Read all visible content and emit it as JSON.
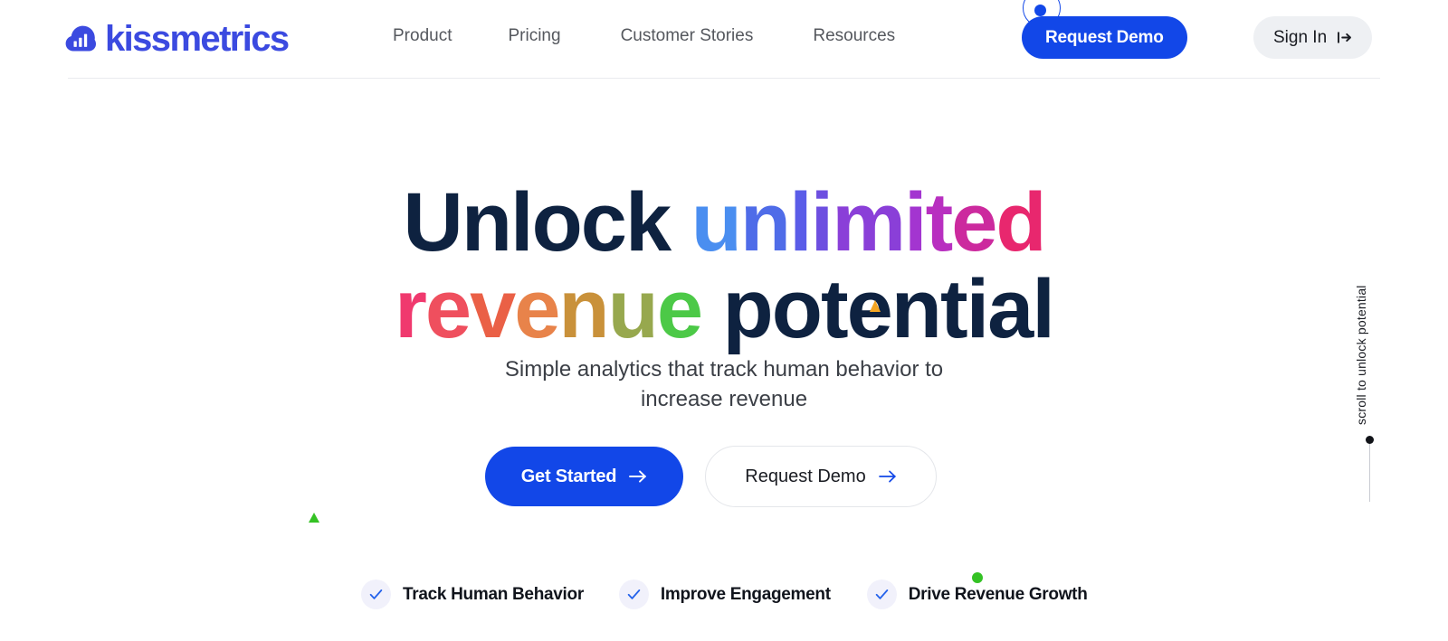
{
  "brand": {
    "name": "kissmetrics",
    "logo_icon": "cloud-bar-chart-icon",
    "color": "#3b4ae0"
  },
  "header": {
    "nav": [
      {
        "label": "Product"
      },
      {
        "label": "Pricing"
      },
      {
        "label": "Customer Stories"
      },
      {
        "label": "Resources"
      }
    ],
    "request_demo_label": "Request Demo",
    "request_demo_color": "#1247e8",
    "signin_label": "Sign In",
    "signin_icon": "sign-in-arrow-icon",
    "signin_bg": "#eef0f3"
  },
  "hero": {
    "headline_line1": [
      {
        "t": "U",
        "c": "#0e2240"
      },
      {
        "t": "n",
        "c": "#0e2240"
      },
      {
        "t": "l",
        "c": "#0e2240"
      },
      {
        "t": "o",
        "c": "#0e2240"
      },
      {
        "t": "c",
        "c": "#0e2240"
      },
      {
        "t": "k",
        "c": "#0e2240"
      },
      {
        "t": " ",
        "c": "#0e2240"
      },
      {
        "t": "u",
        "c": "#4a8ef0"
      },
      {
        "t": "n",
        "c": "#4f6ce8"
      },
      {
        "t": "l",
        "c": "#5a5ce8"
      },
      {
        "t": "i",
        "c": "#6d4fe0"
      },
      {
        "t": "m",
        "c": "#8a3fd8"
      },
      {
        "t": "i",
        "c": "#a335d0"
      },
      {
        "t": "t",
        "c": "#b82fc0"
      },
      {
        "t": "e",
        "c": "#cc2a9e"
      },
      {
        "t": "d",
        "c": "#e8276e"
      }
    ],
    "headline_line2": [
      {
        "t": "r",
        "c": "#f0396e"
      },
      {
        "t": "e",
        "c": "#ef4f5e"
      },
      {
        "t": "v",
        "c": "#ea6046"
      },
      {
        "t": "e",
        "c": "#e8834a"
      },
      {
        "t": "n",
        "c": "#c9913a"
      },
      {
        "t": "u",
        "c": "#97a84e"
      },
      {
        "t": "e",
        "c": "#4cc947"
      },
      {
        "t": " ",
        "c": "#0e2240"
      },
      {
        "t": "p",
        "c": "#0e2240"
      },
      {
        "t": "o",
        "c": "#0e2240"
      },
      {
        "t": "t",
        "c": "#0e2240"
      },
      {
        "t": "e",
        "c": "#0e2240"
      },
      {
        "t": "n",
        "c": "#0e2240"
      },
      {
        "t": "t",
        "c": "#0e2240"
      },
      {
        "t": "i",
        "c": "#0e2240"
      },
      {
        "t": "a",
        "c": "#0e2240"
      },
      {
        "t": "l",
        "c": "#0e2240"
      }
    ],
    "headline_plain": "Unlock unlimited revenue potential",
    "subheading_line1": "Simple analytics that track human behavior to",
    "subheading_line2": "increase revenue",
    "cta_primary_label": "Get Started",
    "cta_primary_icon": "arrow-right-icon",
    "cta_secondary_label": "Request Demo",
    "cta_secondary_icon": "arrow-right-icon"
  },
  "features": [
    {
      "label": "Track Human Behavior",
      "icon": "check-icon"
    },
    {
      "label": "Improve Engagement",
      "icon": "check-icon"
    },
    {
      "label": "Drive Revenue Growth",
      "icon": "check-icon"
    }
  ],
  "scroll_hint": {
    "text": "scroll to unlock potential"
  },
  "decorations": {
    "green_triangle": "#34c224",
    "green_dot": "#34c224",
    "orange_triangle": "#f5a623"
  }
}
